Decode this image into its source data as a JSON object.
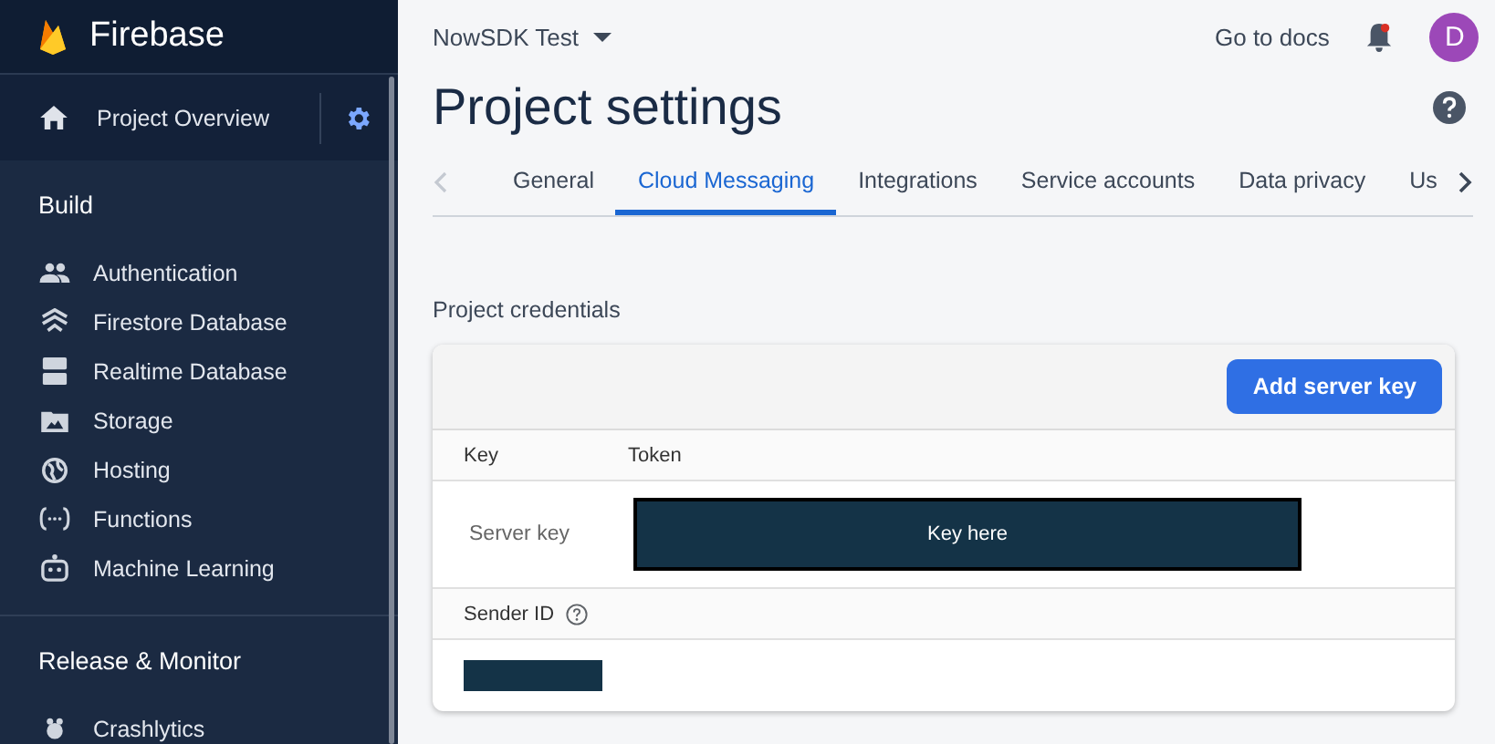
{
  "sidebar": {
    "brand": "Firebase",
    "project_overview": "Project Overview",
    "sections": [
      {
        "title": "Build",
        "items": [
          "Authentication",
          "Firestore Database",
          "Realtime Database",
          "Storage",
          "Hosting",
          "Functions",
          "Machine Learning"
        ]
      },
      {
        "title": "Release & Monitor",
        "items": [
          "Crashlytics"
        ]
      }
    ]
  },
  "topbar": {
    "project": "NowSDK Test",
    "docs_link": "Go to docs",
    "avatar": "D"
  },
  "page_title": "Project settings",
  "tabs": [
    {
      "label": "General",
      "selected": false
    },
    {
      "label": "Cloud Messaging",
      "selected": true
    },
    {
      "label": "Integrations",
      "selected": false
    },
    {
      "label": "Service accounts",
      "selected": false
    },
    {
      "label": "Data privacy",
      "selected": false
    },
    {
      "label": "Us",
      "selected": false
    }
  ],
  "section_title": "Project credentials",
  "card": {
    "button": "Add server key",
    "columns": [
      "Key",
      "Token"
    ],
    "rows": [
      {
        "key": "Server key",
        "token": "Key here"
      }
    ],
    "sender_id_label": "Sender ID"
  }
}
